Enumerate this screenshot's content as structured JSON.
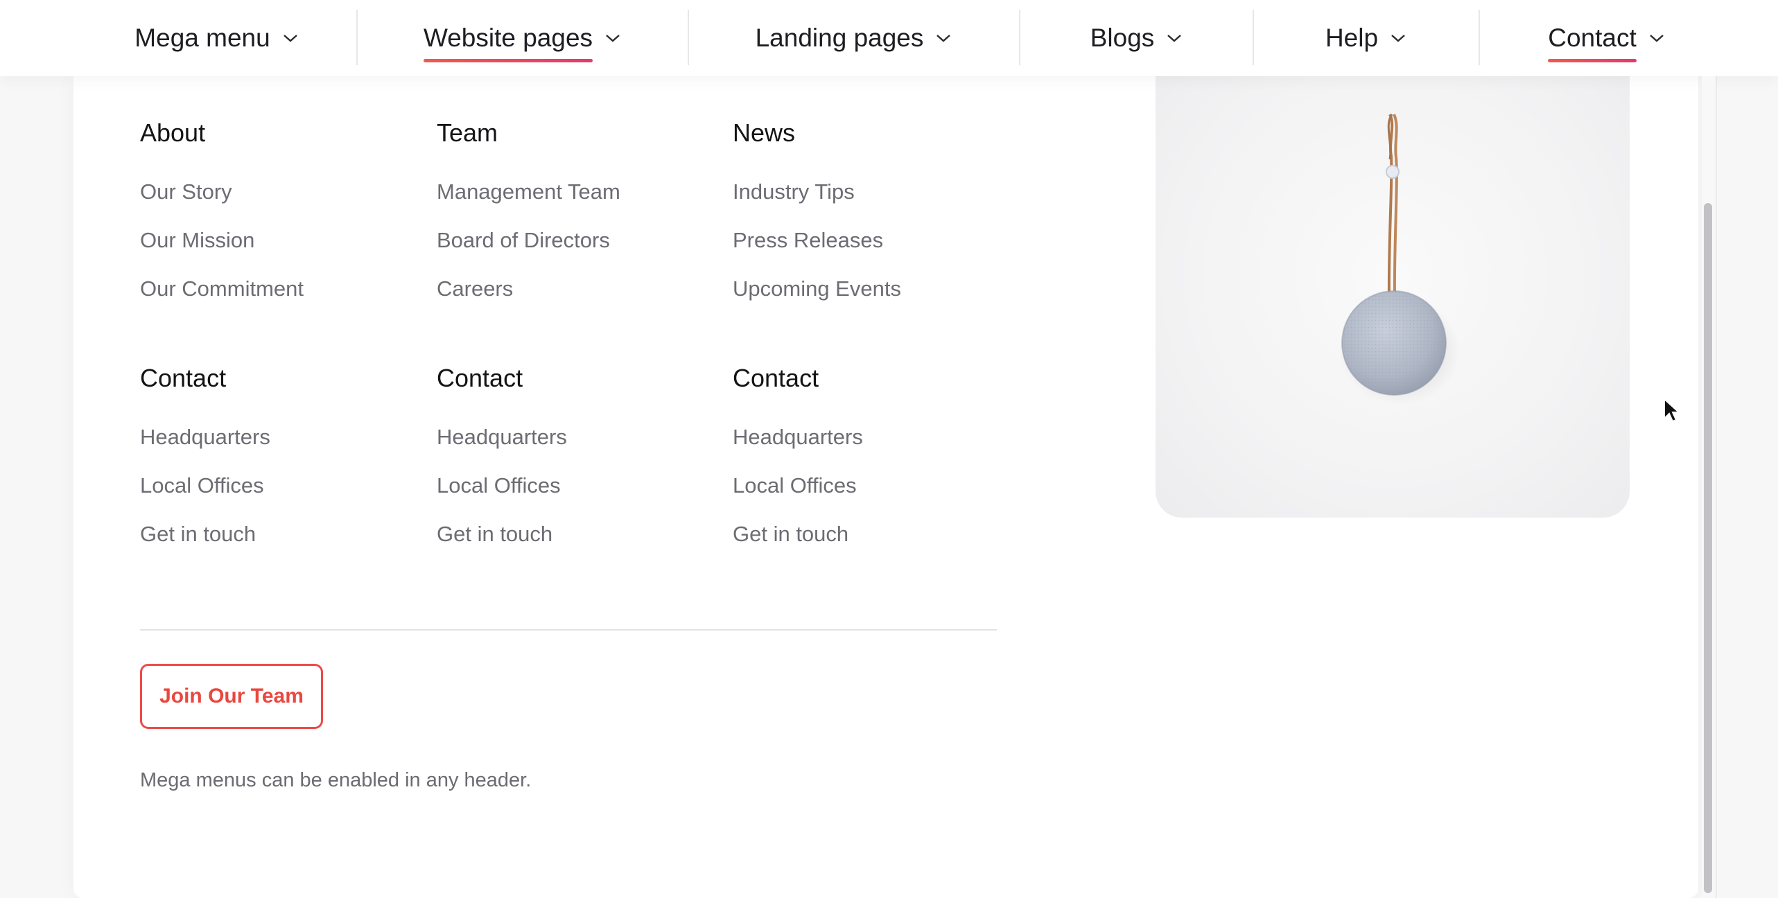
{
  "nav": {
    "items": [
      {
        "label": "Mega menu"
      },
      {
        "label": "Website pages"
      },
      {
        "label": "Landing pages"
      },
      {
        "label": "Blogs"
      },
      {
        "label": "Help"
      },
      {
        "label": "Contact"
      }
    ],
    "accent_gradient": [
      "#ee5a4f",
      "#e23b6c"
    ]
  },
  "menu": {
    "columns": [
      {
        "heading": "About",
        "links": [
          "Our Story",
          "Our Mission",
          "Our Commitment"
        ]
      },
      {
        "heading": "Team",
        "links": [
          "Management Team",
          "Board of Directors",
          "Careers"
        ]
      },
      {
        "heading": "News",
        "links": [
          "Industry Tips",
          "Press Releases",
          "Upcoming Events"
        ]
      },
      {
        "heading": "Contact",
        "links": [
          "Headquarters",
          "Local Offices",
          "Get in touch"
        ]
      },
      {
        "heading": "Contact",
        "links": [
          "Headquarters",
          "Local Offices",
          "Get in touch"
        ]
      },
      {
        "heading": "Contact",
        "links": [
          "Headquarters",
          "Local Offices",
          "Get in touch"
        ]
      }
    ],
    "cta_label": "Join Our Team",
    "cta_color": "#ec4b47",
    "footnote": "Mega menus can be enabled in any header.",
    "feature_image": "hanging-speaker-image"
  }
}
